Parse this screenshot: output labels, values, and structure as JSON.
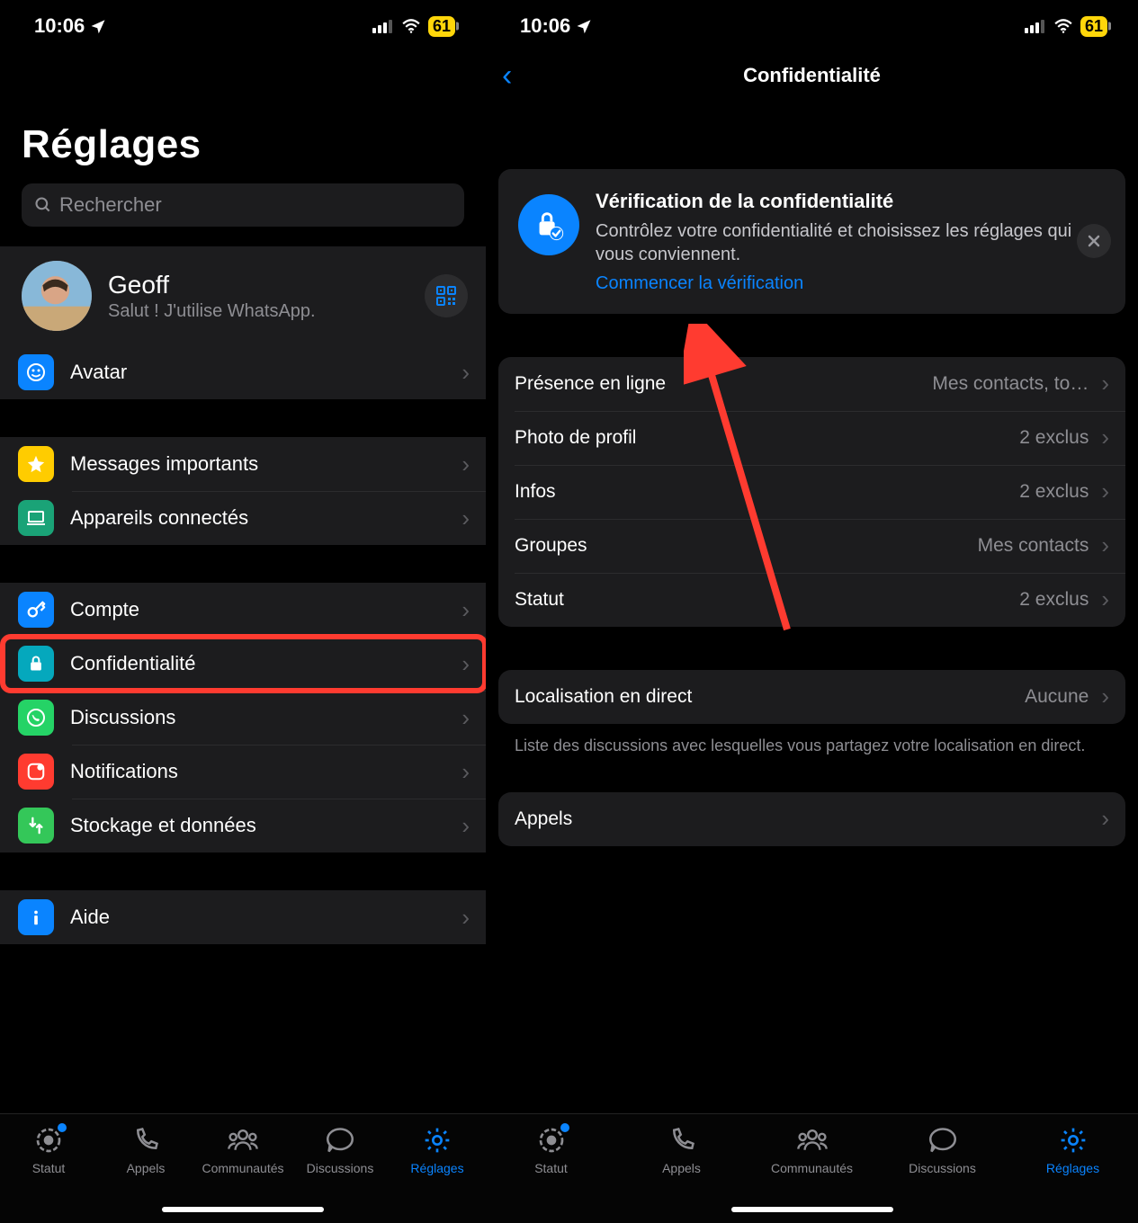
{
  "status": {
    "time": "10:06",
    "battery": "61"
  },
  "left": {
    "title": "Réglages",
    "search_placeholder": "Rechercher",
    "profile": {
      "name": "Geoff",
      "status": "Salut ! J'utilise WhatsApp."
    },
    "avatar_row": "Avatar",
    "rows2": {
      "starred": "Messages importants",
      "linked": "Appareils connectés"
    },
    "rows3": {
      "account": "Compte",
      "privacy": "Confidentialité",
      "chats": "Discussions",
      "notifications": "Notifications",
      "storage": "Stockage et données"
    },
    "rows4": {
      "help": "Aide"
    }
  },
  "right": {
    "nav_title": "Confidentialité",
    "card": {
      "title": "Vérification de la confidentialité",
      "text": "Contrôlez votre confidentialité et choisissez les réglages qui vous conviennent.",
      "link": "Commencer la vérification"
    },
    "g1": {
      "last_seen": {
        "label": "Présence en ligne",
        "value": "Mes contacts, to…"
      },
      "photo": {
        "label": "Photo de profil",
        "value": "2 exclus"
      },
      "infos": {
        "label": "Infos",
        "value": "2 exclus"
      },
      "groups": {
        "label": "Groupes",
        "value": "Mes contacts"
      },
      "status": {
        "label": "Statut",
        "value": "2 exclus"
      }
    },
    "g2": {
      "live": {
        "label": "Localisation en direct",
        "value": "Aucune"
      }
    },
    "g2_footer": "Liste des discussions avec lesquelles vous partagez votre localisation en direct.",
    "g3": {
      "calls": {
        "label": "Appels"
      }
    }
  },
  "tabs": {
    "status": "Statut",
    "calls": "Appels",
    "communities": "Communautés",
    "chats": "Discussions",
    "settings": "Réglages"
  }
}
